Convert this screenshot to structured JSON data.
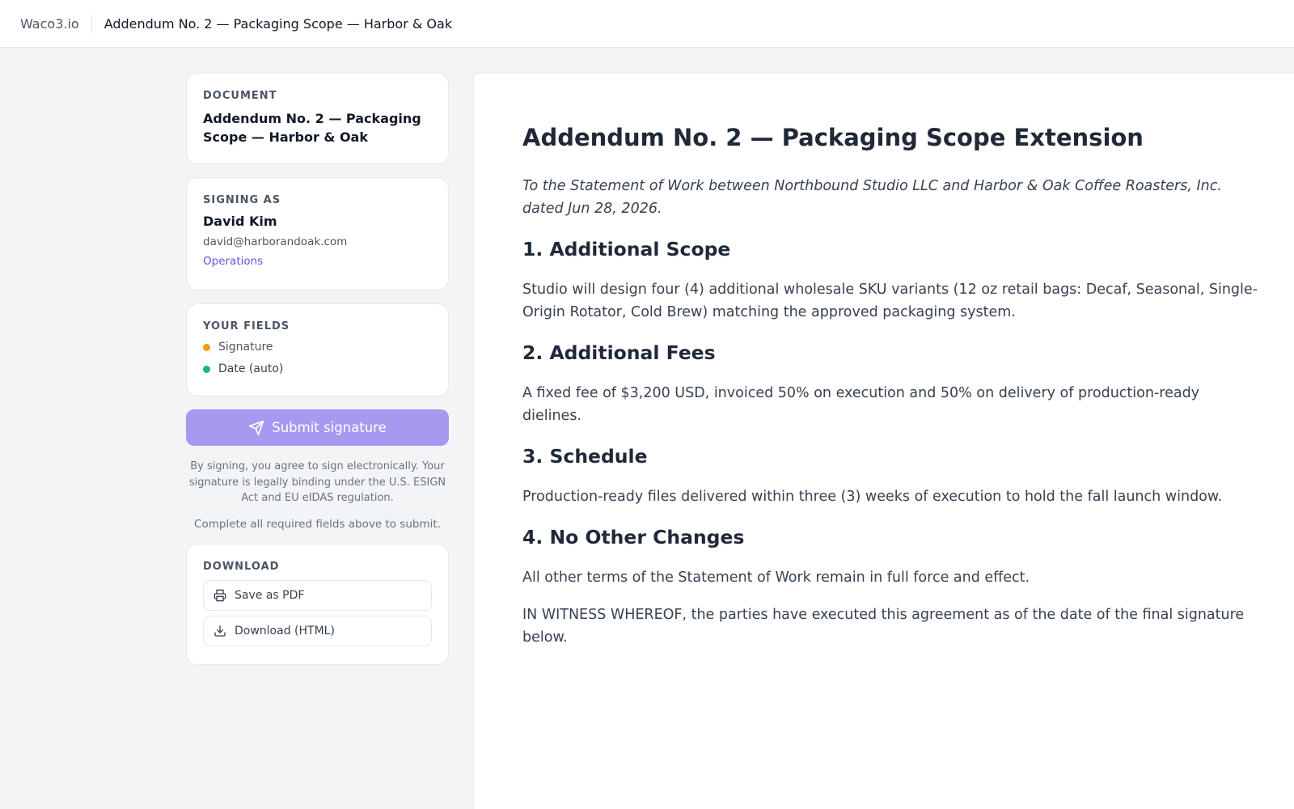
{
  "topbar": {
    "brand": "Waco3.io",
    "title": "Addendum No. 2 — Packaging Scope — Harbor & Oak"
  },
  "sidebar": {
    "document": {
      "label": "DOCUMENT",
      "name": "Addendum No. 2 — Packaging Scope — Harbor & Oak"
    },
    "signer": {
      "label": "SIGNING AS",
      "name": "David Kim",
      "email": "david@harborandoak.com",
      "department": "Operations"
    },
    "fields": {
      "label": "YOUR FIELDS",
      "items": [
        {
          "label": "Signature",
          "color": "#f59e0b"
        },
        {
          "label": "Date (auto)",
          "color": "#10b981"
        }
      ]
    },
    "submit_label": "Submit signature",
    "legal_text": "By signing, you agree to sign electronically. Your signature is legally binding under the U.S. ESIGN Act and EU eIDAS regulation.",
    "complete_note": "Complete all required fields above to submit.",
    "download": {
      "label": "DOWNLOAD",
      "pdf_label": "Save as PDF",
      "html_label": "Download (HTML)"
    }
  },
  "document": {
    "title": "Addendum No. 2 — Packaging Scope Extension",
    "intro": "To the Statement of Work between Northbound Studio LLC and Harbor & Oak Coffee Roasters, Inc. dated Jun 28, 2026.",
    "sections": [
      {
        "heading": "1. Additional Scope",
        "body": "Studio will design four (4) additional wholesale SKU variants (12 oz retail bags: Decaf, Seasonal, Single-Origin Rotator, Cold Brew) matching the approved packaging system."
      },
      {
        "heading": "2. Additional Fees",
        "body": "A fixed fee of $3,200 USD, invoiced 50% on execution and 50% on delivery of production-ready dielines."
      },
      {
        "heading": "3. Schedule",
        "body": "Production-ready files delivered within three (3) weeks of execution to hold the fall launch window."
      },
      {
        "heading": "4. No Other Changes",
        "body": "All other terms of the Statement of Work remain in full force and effect."
      }
    ],
    "closing": "IN WITNESS WHEREOF, the parties have executed this agreement as of the date of the final signature below."
  },
  "colors": {
    "accent": "#6d4fd9",
    "submit_disabled": "#a59af0"
  }
}
